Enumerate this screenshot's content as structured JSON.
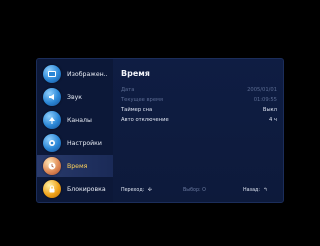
{
  "sidebar": {
    "items": [
      {
        "label": "Изображен..",
        "icon": "picture-icon"
      },
      {
        "label": "Звук",
        "icon": "sound-icon"
      },
      {
        "label": "Каналы",
        "icon": "antenna-icon"
      },
      {
        "label": "Настройки",
        "icon": "settings-icon"
      },
      {
        "label": "Время",
        "icon": "clock-icon"
      },
      {
        "label": "Блокировка",
        "icon": "lock-icon"
      }
    ],
    "active": "Время"
  },
  "main": {
    "title": "Время",
    "rows": [
      {
        "key": "Дата",
        "value": "2005/01/01"
      },
      {
        "key": "Текущее время",
        "value": "01:09:55"
      },
      {
        "key": "Таймер сна",
        "value": "Выкл"
      },
      {
        "key": "Авто отключение",
        "value": "4 ч"
      }
    ]
  },
  "footer": {
    "navigate": "Переход:",
    "select": "Выбор: O",
    "back": "Назад:"
  },
  "colors": {
    "panel_bg": "#0f1d43",
    "active_label": "#ffd35a",
    "dim_text": "#5b6b92"
  }
}
